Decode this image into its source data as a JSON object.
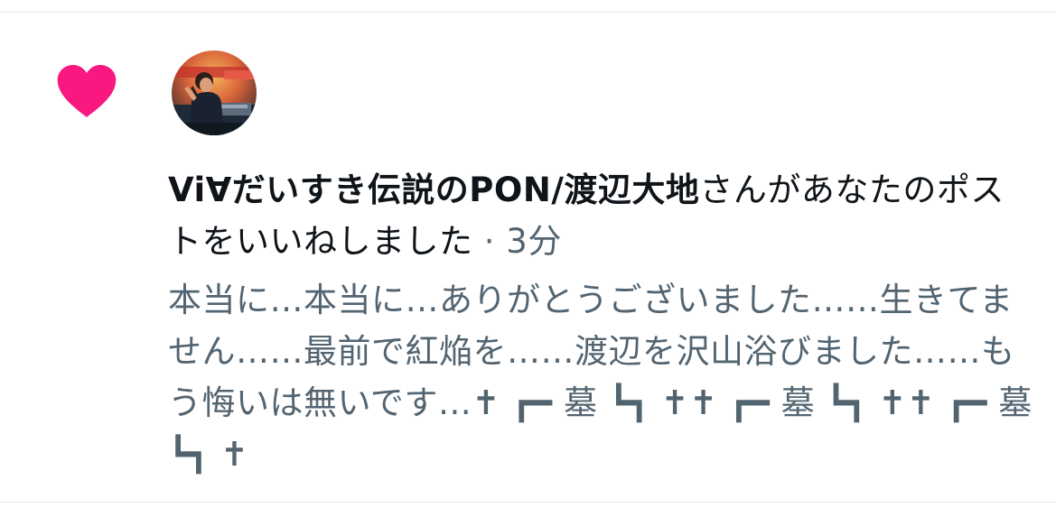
{
  "notification": {
    "type_icon": "heart-icon",
    "user_name": "Vi∀だいすき伝説のPON/渡辺大地",
    "action_text": "さんがあなたのポストをいいねしました",
    "separator": " · ",
    "time_ago": "3分",
    "post_text": "本当に…本当に…ありがとうございました……生きてません……最前で紅焔を……渡辺を沢山浴びました……もう悔いは無いです…✝︎ ┏━ 墓 ┗┓ ✝︎✝︎ ┏━ 墓 ┗┓ ✝︎✝︎ ┏━ 墓 ┗┓ ✝︎"
  },
  "colors": {
    "heart": "#f91880",
    "text_primary": "#0f1419",
    "text_secondary": "#536471",
    "divider": "#e6e8ea"
  }
}
